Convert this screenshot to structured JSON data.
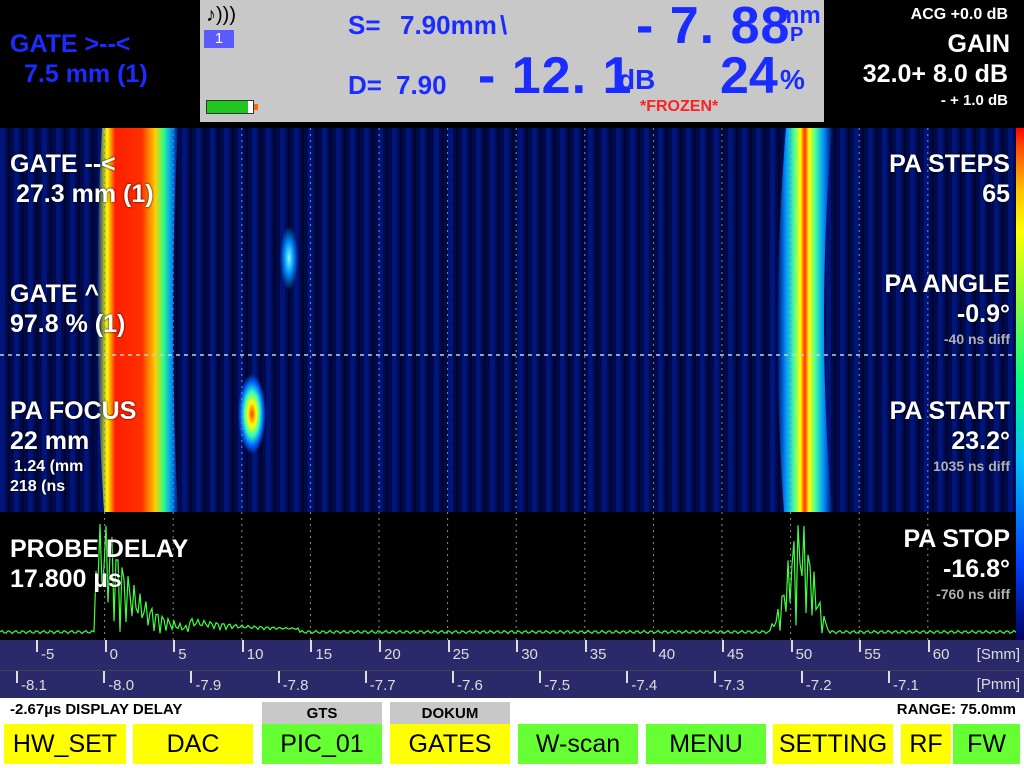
{
  "header": {
    "gate_left": {
      "title": "GATE >--<",
      "value": "7.5 mm (1)"
    },
    "center": {
      "channel": "1",
      "s_label": "S=",
      "s_value": "7.90mm",
      "s_suffix": "\\",
      "d_label": "D=",
      "d_value": "7.90",
      "big_value": "- 7. 88",
      "big_unit": "mm",
      "big_unit_sub": "P",
      "db_value": "- 12. 1",
      "db_unit": "dB",
      "percent_value": "24",
      "percent_unit": "%",
      "status": "*FROZEN*",
      "battery_level": 0.9
    },
    "gain": {
      "acg": "ACG +0.0 dB",
      "title": "GAIN",
      "value": "32.0+ 8.0 dB",
      "step": "- + 1.0 dB"
    }
  },
  "overlay_left": {
    "gate2_title": "GATE --<",
    "gate2_value": "27.3 mm (1)",
    "gate3_title": "GATE ^",
    "gate3_value": "97.8 % (1)",
    "focus_title": "PA FOCUS",
    "focus_value": "22 mm",
    "focus_sub1": "1.24 (mm",
    "focus_sub2": "218 (ns",
    "probe_title": "PROBE DELAY",
    "probe_value": "17.800 µs"
  },
  "overlay_right": {
    "steps_title": "PA STEPS",
    "steps_value": "65",
    "angle_title": "PA ANGLE",
    "angle_value": "-0.9°",
    "angle_diff": "-40 ns diff",
    "start_title": "PA START",
    "start_value": "23.2°",
    "start_diff": "1035 ns diff",
    "stop_title": "PA STOP",
    "stop_value": "-16.8°",
    "stop_diff": "-760 ns diff"
  },
  "scale_smm": {
    "unit": "[Smm]",
    "ticks": [
      "-5",
      "0",
      "5",
      "10",
      "15",
      "20",
      "25",
      "30",
      "35",
      "40",
      "45",
      "50",
      "55",
      "60"
    ]
  },
  "scale_pmm": {
    "unit": "[Pmm]",
    "ticks": [
      "-8.1",
      "-8.0",
      "-7.9",
      "-7.8",
      "-7.7",
      "-7.6",
      "-7.5",
      "-7.4",
      "-7.3",
      "-7.2",
      "-7.1"
    ]
  },
  "footer": {
    "display_delay": "-2.67µs  DISPLAY DELAY",
    "range": "RANGE:  75.0mm",
    "tab_gts": "GTS",
    "tab_dokum": "DOKUM",
    "keys": [
      "HW_SET",
      "DAC",
      "PIC_01",
      "GATES",
      "W-scan",
      "MENU",
      "SETTING",
      "RF",
      "FW"
    ]
  },
  "colors": {
    "header_blue": "#1a2cff",
    "frozen_red": "#ff2020",
    "key_yellow": "#ffff00",
    "key_green": "#66ff33"
  }
}
